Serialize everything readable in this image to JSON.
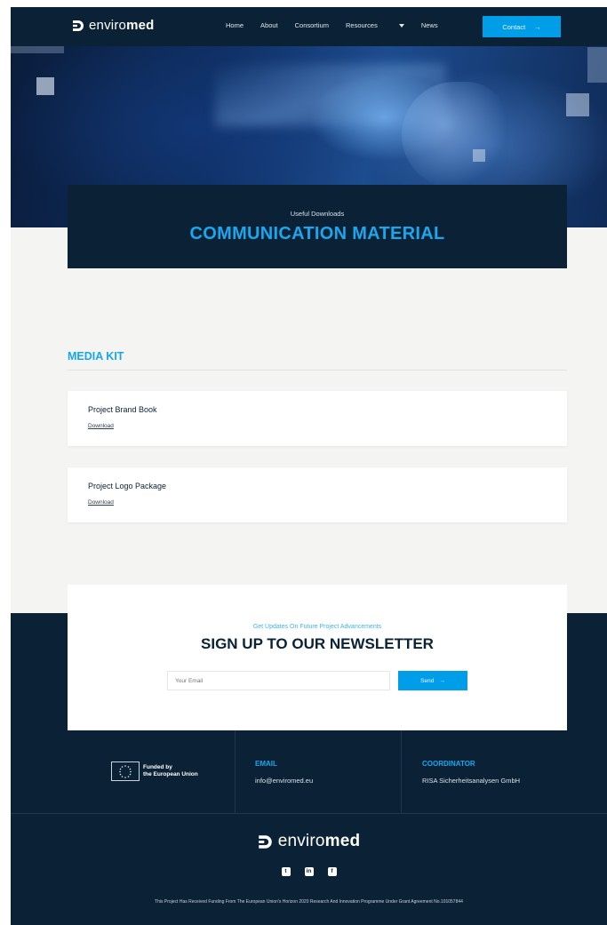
{
  "brand": {
    "name_light": "enviro",
    "name_bold": "med"
  },
  "nav": {
    "items": [
      {
        "label": "Home"
      },
      {
        "label": "About"
      },
      {
        "label": "Consortium"
      },
      {
        "label": "Resources",
        "has_dropdown": true
      },
      {
        "label": "News"
      }
    ],
    "contact_label": "Contact",
    "contact_arrow": "→"
  },
  "hero": {
    "kicker": "Useful Downloads",
    "title": "COMMUNICATION MATERIAL"
  },
  "media_kit": {
    "title": "MEDIA KIT",
    "items": [
      {
        "name": "Project Brand Book",
        "link": "Download"
      },
      {
        "name": "Project Logo Package",
        "link": "Download"
      }
    ]
  },
  "newsletter": {
    "kicker": "Get Updates On Future Project Advancements",
    "title": "SIGN UP TO OUR NEWSLETTER",
    "email_placeholder": "Your Email",
    "send_label": "Send",
    "send_arrow": "→"
  },
  "footer": {
    "funding_line1": "Funded by",
    "funding_line2": "the European Union",
    "email_label": "EMAIL",
    "email_value": "info@enviromed.eu",
    "coordinator_label": "COORDINATOR",
    "coordinator_value": "RISA Sicherheitsanalysen GmbH",
    "socials": [
      {
        "icon": "twitter-icon",
        "glyph": "t"
      },
      {
        "icon": "linkedin-icon",
        "glyph": "in"
      },
      {
        "icon": "facebook-icon",
        "glyph": "f"
      }
    ],
    "legal": "This Project Has Received Funding From The European Union's Horizon 2020 Research And Innovation Programme Under Grant Agreement No.101057844"
  },
  "colors": {
    "navy": "#0b2236",
    "accent": "#009ee8",
    "accent_text": "#1aa7ee",
    "page_bg": "#f4f4f2"
  }
}
